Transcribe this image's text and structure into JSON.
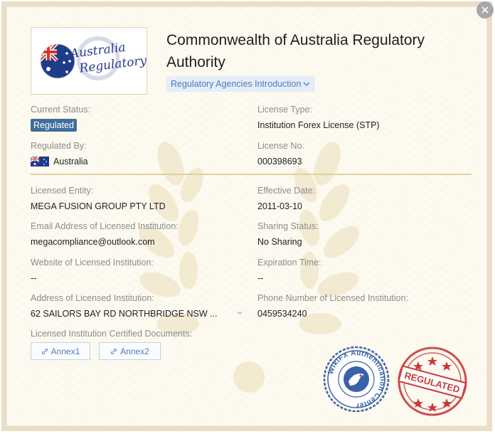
{
  "header": {
    "title": "Commonwealth of Australia Regulatory Authority",
    "intro_label": "Regulatory Agencies Introduction"
  },
  "logo": {
    "line1": "Australia",
    "line2": "Regulatory"
  },
  "fields": {
    "current_status": {
      "label": "Current Status:",
      "value": "Regulated"
    },
    "license_type": {
      "label": "License Type:",
      "value": "Institution Forex License (STP)"
    },
    "regulated_by": {
      "label": "Regulated By:",
      "value": "Australia"
    },
    "license_no": {
      "label": "License No.",
      "value": "000398693"
    },
    "licensed_entity": {
      "label": "Licensed Entity:",
      "value": "MEGA FUSION GROUP PTY LTD"
    },
    "effective_date": {
      "label": "Effective Date:",
      "value": "2011-03-10"
    },
    "email": {
      "label": "Email Address of Licensed Institution:",
      "value": "megacompliance@outlook.com"
    },
    "sharing_status": {
      "label": "Sharing Status:",
      "value": "No Sharing"
    },
    "website": {
      "label": "Website of Licensed Institution:",
      "value": "--"
    },
    "expiration": {
      "label": "Expiration Time:",
      "value": "--"
    },
    "address": {
      "label": "Address of Licensed Institution:",
      "value": "62 SAILORS BAY RD NORTHBRIDGE NSW ..."
    },
    "phone": {
      "label": "Phone Number of Licensed Institution:",
      "value": "0459534240"
    },
    "documents": {
      "label": "Licensed Institution Certified Documents:"
    }
  },
  "annexes": [
    "Annex1",
    "Annex2"
  ],
  "seals": {
    "wikifx_text": "WikiFX Authentication Center",
    "regulated_text": "REGULATED"
  },
  "colors": {
    "badge": "#3f6e9b",
    "link": "#4a7bc0",
    "divider": "#e1cf9c",
    "seal_blue": "#3a62a8",
    "seal_red": "#c83a3a"
  },
  "icons": [
    "close-icon",
    "chevron-down-icon",
    "australia-flag-icon",
    "link-icon",
    "eagle-icon",
    "star-icon"
  ]
}
